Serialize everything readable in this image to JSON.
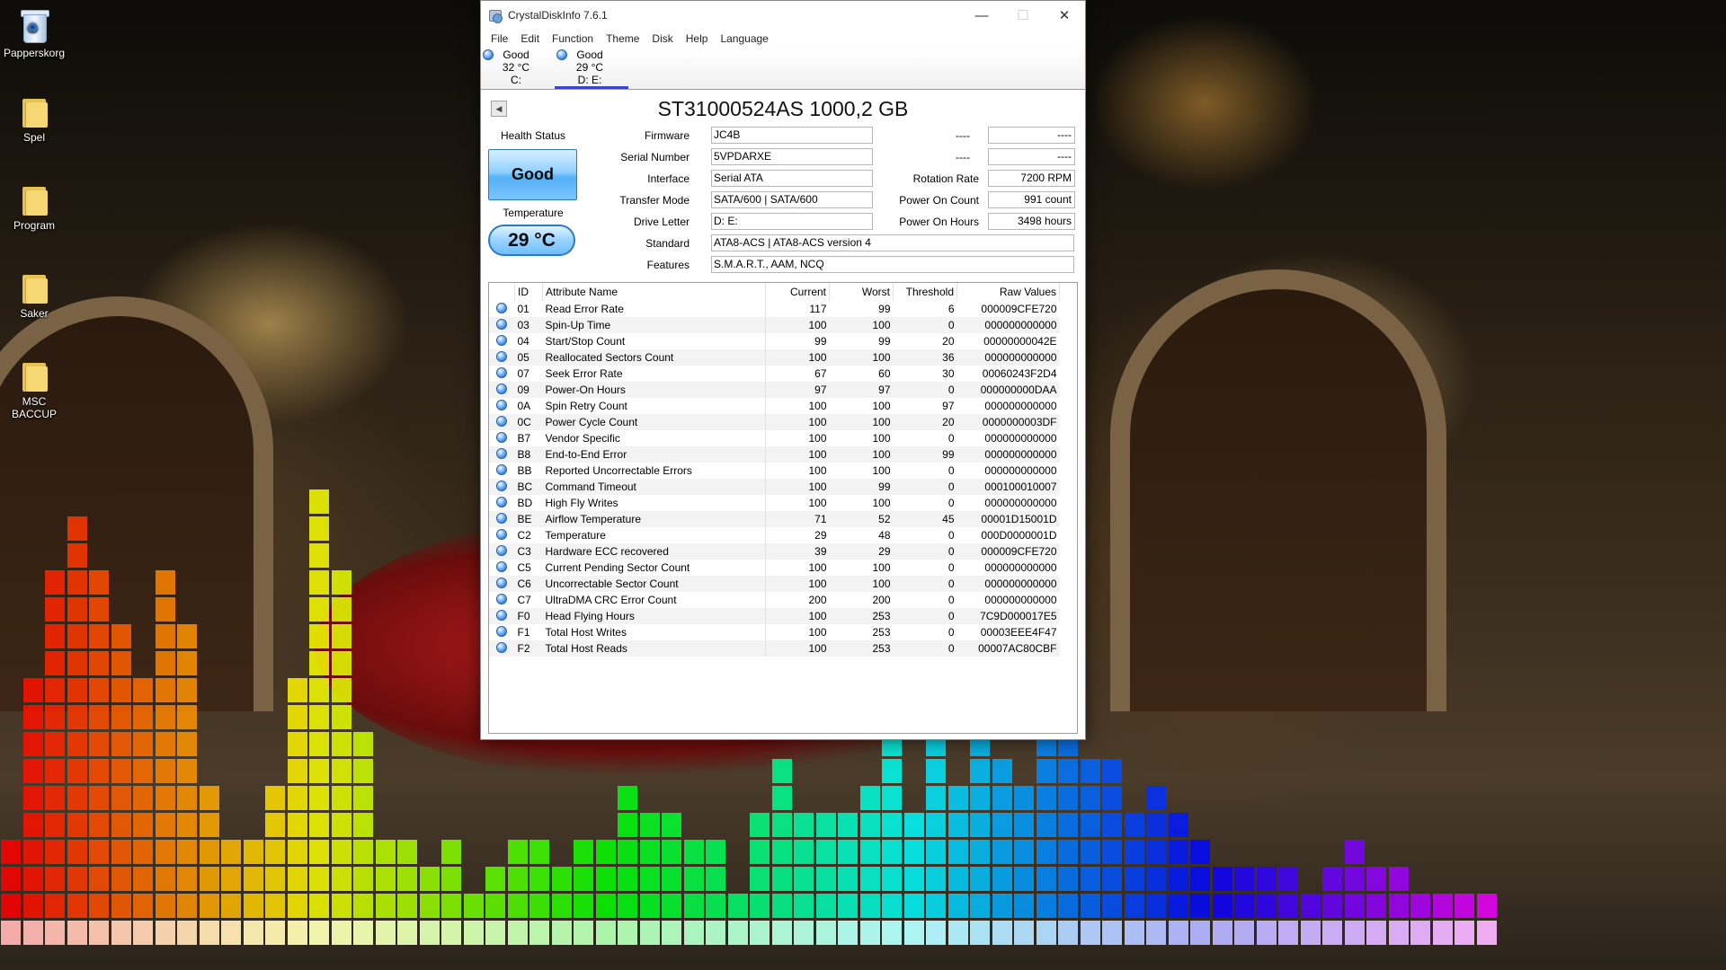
{
  "desktop": {
    "icons": [
      {
        "label": "Papperskorg",
        "type": "recycle-bin"
      },
      {
        "label": "Spel",
        "type": "folder"
      },
      {
        "label": "Program",
        "type": "folder"
      },
      {
        "label": "Saker",
        "type": "folder"
      },
      {
        "label": "MSC BACCUP",
        "type": "folder"
      }
    ]
  },
  "window": {
    "title": "CrystalDiskInfo 7.6.1",
    "controls": {
      "minimize": "—",
      "maximize": "☐",
      "close": "✕"
    },
    "menu": [
      "File",
      "Edit",
      "Function",
      "Theme",
      "Disk",
      "Help",
      "Language"
    ],
    "disk_tabs": [
      {
        "status": "Good",
        "temp": "32 °C",
        "drive": "C:",
        "active": false
      },
      {
        "status": "Good",
        "temp": "29 °C",
        "drive": "D: E:",
        "active": true
      }
    ]
  },
  "disk": {
    "title": "ST31000524AS 1000,2 GB",
    "health_label": "Health Status",
    "health_value": "Good",
    "temperature_label": "Temperature",
    "temperature_value": "29 °C",
    "labels": {
      "firmware": "Firmware",
      "serial": "Serial Number",
      "interface": "Interface",
      "transfer_mode": "Transfer Mode",
      "drive_letter": "Drive Letter",
      "standard": "Standard",
      "features": "Features",
      "extra1": "----",
      "extra2": "----",
      "rotation_rate": "Rotation Rate",
      "power_on_count": "Power On Count",
      "power_on_hours": "Power On Hours"
    },
    "values": {
      "firmware": "JC4B",
      "serial": "5VPDARXE",
      "interface": "Serial ATA",
      "transfer_mode": "SATA/600 | SATA/600",
      "drive_letter": "D: E:",
      "standard": "ATA8-ACS | ATA8-ACS version 4",
      "features": "S.M.A.R.T., AAM, NCQ",
      "extra1": "----",
      "extra2": "----",
      "rotation_rate": "7200 RPM",
      "power_on_count": "991 count",
      "power_on_hours": "3498 hours"
    }
  },
  "smart": {
    "headers": {
      "id": "ID",
      "name": "Attribute Name",
      "current": "Current",
      "worst": "Worst",
      "threshold": "Threshold",
      "raw": "Raw Values"
    },
    "rows": [
      {
        "id": "01",
        "name": "Read Error Rate",
        "current": "117",
        "worst": "99",
        "threshold": "6",
        "raw": "000009CFE720"
      },
      {
        "id": "03",
        "name": "Spin-Up Time",
        "current": "100",
        "worst": "100",
        "threshold": "0",
        "raw": "000000000000"
      },
      {
        "id": "04",
        "name": "Start/Stop Count",
        "current": "99",
        "worst": "99",
        "threshold": "20",
        "raw": "00000000042E"
      },
      {
        "id": "05",
        "name": "Reallocated Sectors Count",
        "current": "100",
        "worst": "100",
        "threshold": "36",
        "raw": "000000000000"
      },
      {
        "id": "07",
        "name": "Seek Error Rate",
        "current": "67",
        "worst": "60",
        "threshold": "30",
        "raw": "00060243F2D4"
      },
      {
        "id": "09",
        "name": "Power-On Hours",
        "current": "97",
        "worst": "97",
        "threshold": "0",
        "raw": "000000000DAA"
      },
      {
        "id": "0A",
        "name": "Spin Retry Count",
        "current": "100",
        "worst": "100",
        "threshold": "97",
        "raw": "000000000000"
      },
      {
        "id": "0C",
        "name": "Power Cycle Count",
        "current": "100",
        "worst": "100",
        "threshold": "20",
        "raw": "0000000003DF"
      },
      {
        "id": "B7",
        "name": "Vendor Specific",
        "current": "100",
        "worst": "100",
        "threshold": "0",
        "raw": "000000000000"
      },
      {
        "id": "B8",
        "name": "End-to-End Error",
        "current": "100",
        "worst": "100",
        "threshold": "99",
        "raw": "000000000000"
      },
      {
        "id": "BB",
        "name": "Reported Uncorrectable Errors",
        "current": "100",
        "worst": "100",
        "threshold": "0",
        "raw": "000000000000"
      },
      {
        "id": "BC",
        "name": "Command Timeout",
        "current": "100",
        "worst": "99",
        "threshold": "0",
        "raw": "000100010007"
      },
      {
        "id": "BD",
        "name": "High Fly Writes",
        "current": "100",
        "worst": "100",
        "threshold": "0",
        "raw": "000000000000"
      },
      {
        "id": "BE",
        "name": "Airflow Temperature",
        "current": "71",
        "worst": "52",
        "threshold": "45",
        "raw": "00001D15001D"
      },
      {
        "id": "C2",
        "name": "Temperature",
        "current": "29",
        "worst": "48",
        "threshold": "0",
        "raw": "000D0000001D"
      },
      {
        "id": "C3",
        "name": "Hardware ECC recovered",
        "current": "39",
        "worst": "29",
        "threshold": "0",
        "raw": "000009CFE720"
      },
      {
        "id": "C5",
        "name": "Current Pending Sector Count",
        "current": "100",
        "worst": "100",
        "threshold": "0",
        "raw": "000000000000"
      },
      {
        "id": "C6",
        "name": "Uncorrectable Sector Count",
        "current": "100",
        "worst": "100",
        "threshold": "0",
        "raw": "000000000000"
      },
      {
        "id": "C7",
        "name": "UltraDMA CRC Error Count",
        "current": "200",
        "worst": "200",
        "threshold": "0",
        "raw": "000000000000"
      },
      {
        "id": "F0",
        "name": "Head Flying Hours",
        "current": "100",
        "worst": "253",
        "threshold": "0",
        "raw": "7C9D000017E5"
      },
      {
        "id": "F1",
        "name": "Total Host Writes",
        "current": "100",
        "worst": "253",
        "threshold": "0",
        "raw": "00003EEE4F47"
      },
      {
        "id": "F2",
        "name": "Total Host Reads",
        "current": "100",
        "worst": "253",
        "threshold": "0",
        "raw": "00007AC80CBF"
      }
    ]
  },
  "colors": {
    "health_good": "#55b0f5",
    "accent_tab": "#3a47c8"
  }
}
